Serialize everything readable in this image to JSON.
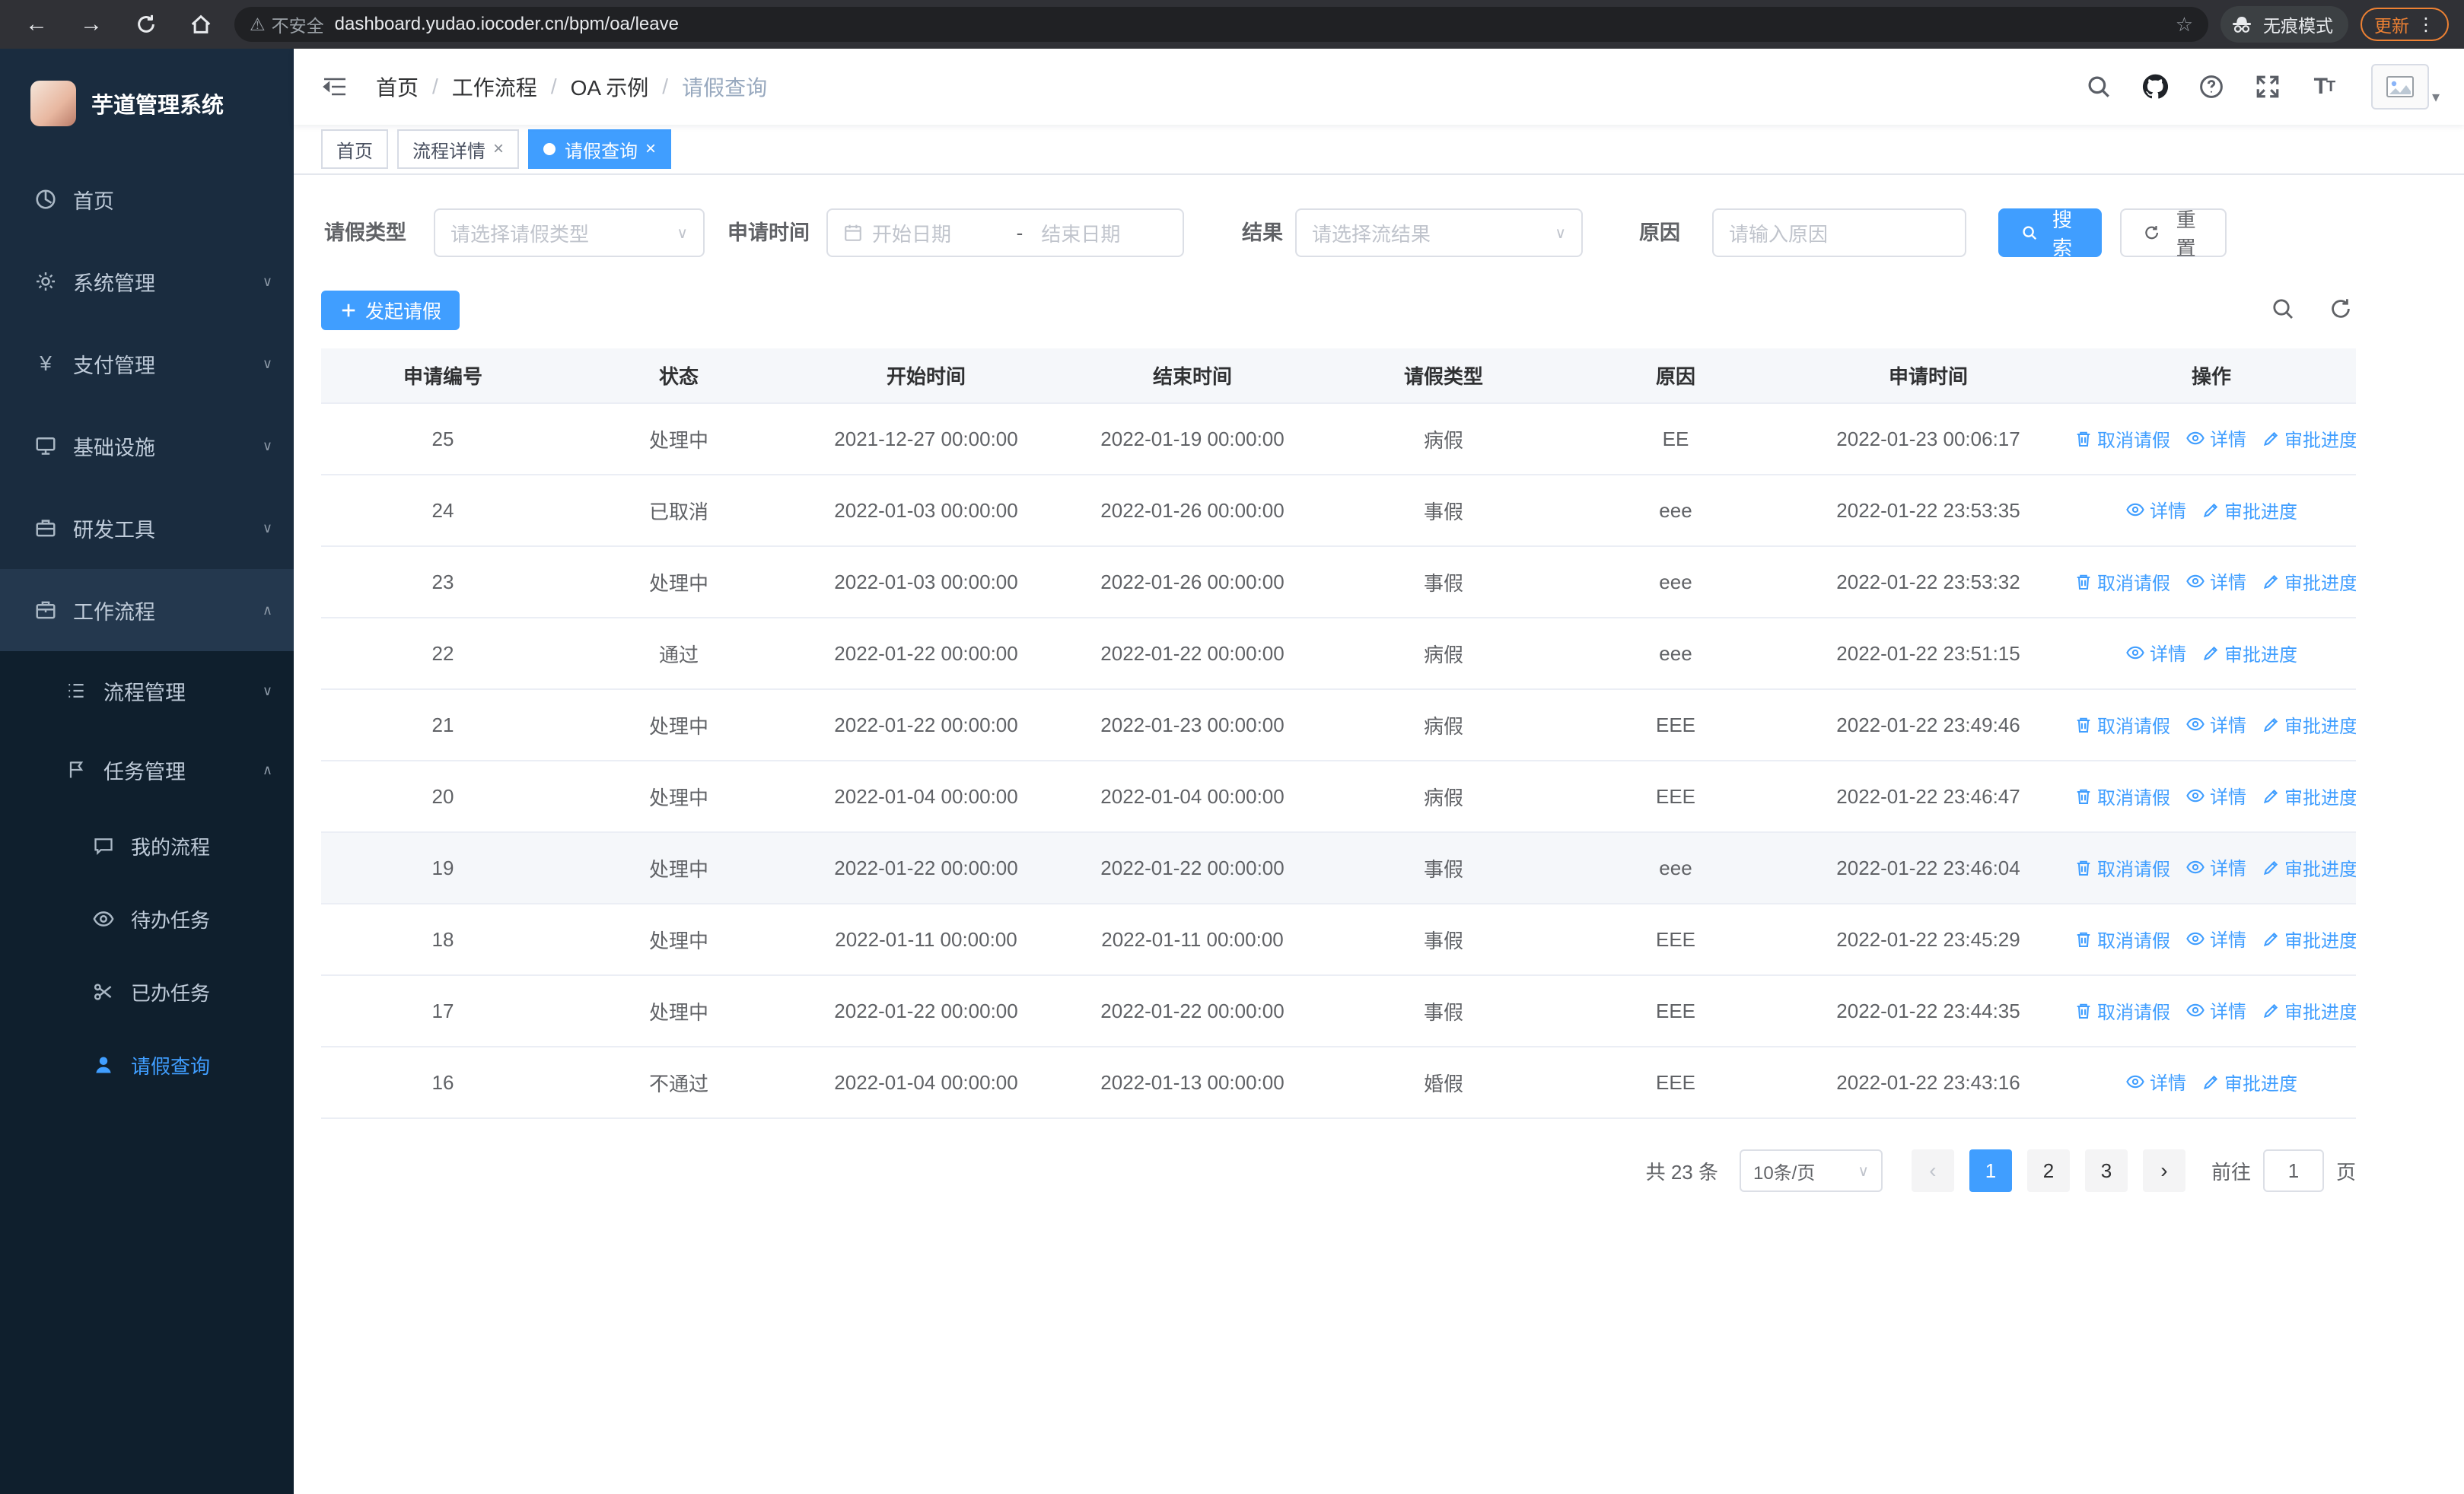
{
  "glyphs": {
    "close": "×",
    "chevron_down": "∨",
    "chevron_up": "∧",
    "caret_down": "∨",
    "avatar_caret": "▾",
    "menu_dots": "⋮",
    "star": "☆",
    "warn": "⚠",
    "back": "←",
    "forward": "→",
    "yen": "¥"
  },
  "browser": {
    "security_label": "不安全",
    "url": "dashboard.yudao.iocoder.cn/bpm/oa/leave",
    "incognito_label": "无痕模式",
    "update_label": "更新"
  },
  "sidebar": {
    "logo_title": "芋道管理系统",
    "menu": [
      {
        "label": "首页",
        "icon": "home-icon"
      },
      {
        "label": "系统管理",
        "icon": "gear-icon",
        "chevron": "∨"
      },
      {
        "label": "支付管理",
        "icon": "payment-icon",
        "chevron": "∨"
      },
      {
        "label": "基础设施",
        "icon": "infrastructure-icon",
        "chevron": "∨"
      },
      {
        "label": "研发工具",
        "icon": "devtools-icon",
        "chevron": "∨"
      },
      {
        "label": "工作流程",
        "icon": "workflow-icon",
        "chevron": "∧",
        "active_parent": true
      },
      {
        "label": "流程管理",
        "icon": "process-icon",
        "chevron": "∨"
      },
      {
        "label": "任务管理",
        "icon": "task-icon",
        "chevron": "∧"
      },
      {
        "label": "我的流程",
        "icon": "my-process-icon"
      },
      {
        "label": "待办任务",
        "icon": "todo-icon"
      },
      {
        "label": "已办任务",
        "icon": "done-icon"
      },
      {
        "label": "请假查询",
        "icon": "user-icon",
        "active": true
      }
    ]
  },
  "header": {
    "breadcrumb": [
      "首页",
      "工作流程",
      "OA 示例",
      "请假查询"
    ],
    "separator": "/",
    "icons": [
      "search-icon",
      "github-icon",
      "help-icon",
      "fullscreen-icon",
      "font-size-icon",
      "avatar"
    ]
  },
  "tabs": [
    {
      "label": "首页",
      "closable": false,
      "active": false
    },
    {
      "label": "流程详情",
      "closable": true,
      "active": false
    },
    {
      "label": "请假查询",
      "closable": true,
      "active": true
    }
  ],
  "filters": {
    "leave_type_label": "请假类型",
    "leave_type_placeholder": "请选择请假类型",
    "apply_time_label": "申请时间",
    "start_date_placeholder": "开始日期",
    "date_separator": "-",
    "end_date_placeholder": "结束日期",
    "result_label": "结果",
    "result_placeholder": "请选择流结果",
    "reason_label": "原因",
    "reason_placeholder": "请输入原因",
    "search_button": "搜索",
    "reset_button": "重置"
  },
  "toolbar": {
    "create_button": "发起请假"
  },
  "table": {
    "columns": [
      "申请编号",
      "状态",
      "开始时间",
      "结束时间",
      "请假类型",
      "原因",
      "申请时间",
      "操作"
    ],
    "col_keys": [
      "id",
      "status",
      "start",
      "end",
      "type",
      "reason",
      "apply_time"
    ],
    "actions": {
      "cancel": "取消请假",
      "detail": "详情",
      "progress": "审批进度"
    },
    "rows": [
      {
        "id": "25",
        "status": "处理中",
        "start": "2021-12-27 00:00:00",
        "end": "2022-01-19 00:00:00",
        "type": "病假",
        "reason": "EE",
        "apply_time": "2022-01-23 00:06:17",
        "cancelable": true,
        "highlight": false
      },
      {
        "id": "24",
        "status": "已取消",
        "start": "2022-01-03 00:00:00",
        "end": "2022-01-26 00:00:00",
        "type": "事假",
        "reason": "eee",
        "apply_time": "2022-01-22 23:53:35",
        "cancelable": false,
        "highlight": false
      },
      {
        "id": "23",
        "status": "处理中",
        "start": "2022-01-03 00:00:00",
        "end": "2022-01-26 00:00:00",
        "type": "事假",
        "reason": "eee",
        "apply_time": "2022-01-22 23:53:32",
        "cancelable": true,
        "highlight": false
      },
      {
        "id": "22",
        "status": "通过",
        "start": "2022-01-22 00:00:00",
        "end": "2022-01-22 00:00:00",
        "type": "病假",
        "reason": "eee",
        "apply_time": "2022-01-22 23:51:15",
        "cancelable": false,
        "highlight": false
      },
      {
        "id": "21",
        "status": "处理中",
        "start": "2022-01-22 00:00:00",
        "end": "2022-01-23 00:00:00",
        "type": "病假",
        "reason": "EEE",
        "apply_time": "2022-01-22 23:49:46",
        "cancelable": true,
        "highlight": false
      },
      {
        "id": "20",
        "status": "处理中",
        "start": "2022-01-04 00:00:00",
        "end": "2022-01-04 00:00:00",
        "type": "病假",
        "reason": "EEE",
        "apply_time": "2022-01-22 23:46:47",
        "cancelable": true,
        "highlight": false
      },
      {
        "id": "19",
        "status": "处理中",
        "start": "2022-01-22 00:00:00",
        "end": "2022-01-22 00:00:00",
        "type": "事假",
        "reason": "eee",
        "apply_time": "2022-01-22 23:46:04",
        "cancelable": true,
        "highlight": true
      },
      {
        "id": "18",
        "status": "处理中",
        "start": "2022-01-11 00:00:00",
        "end": "2022-01-11 00:00:00",
        "type": "事假",
        "reason": "EEE",
        "apply_time": "2022-01-22 23:45:29",
        "cancelable": true,
        "highlight": false
      },
      {
        "id": "17",
        "status": "处理中",
        "start": "2022-01-22 00:00:00",
        "end": "2022-01-22 00:00:00",
        "type": "事假",
        "reason": "EEE",
        "apply_time": "2022-01-22 23:44:35",
        "cancelable": true,
        "highlight": false
      },
      {
        "id": "16",
        "status": "不通过",
        "start": "2022-01-04 00:00:00",
        "end": "2022-01-13 00:00:00",
        "type": "婚假",
        "reason": "EEE",
        "apply_time": "2022-01-22 23:43:16",
        "cancelable": false,
        "highlight": false
      }
    ]
  },
  "pagination": {
    "total": "共 23 条",
    "page_size": "10条/页",
    "pages": [
      "1",
      "2",
      "3"
    ],
    "active_page": "1",
    "prev_glyph": "‹",
    "next_glyph": "›",
    "goto_label": "前往",
    "goto_value": "1",
    "page_label": "页"
  },
  "colors": {
    "accent": "#409eff",
    "sidebar_bg": "#0f1f2d",
    "sidebar_top_bg": "#1a2c3f",
    "update_orange": "#ee8133"
  }
}
